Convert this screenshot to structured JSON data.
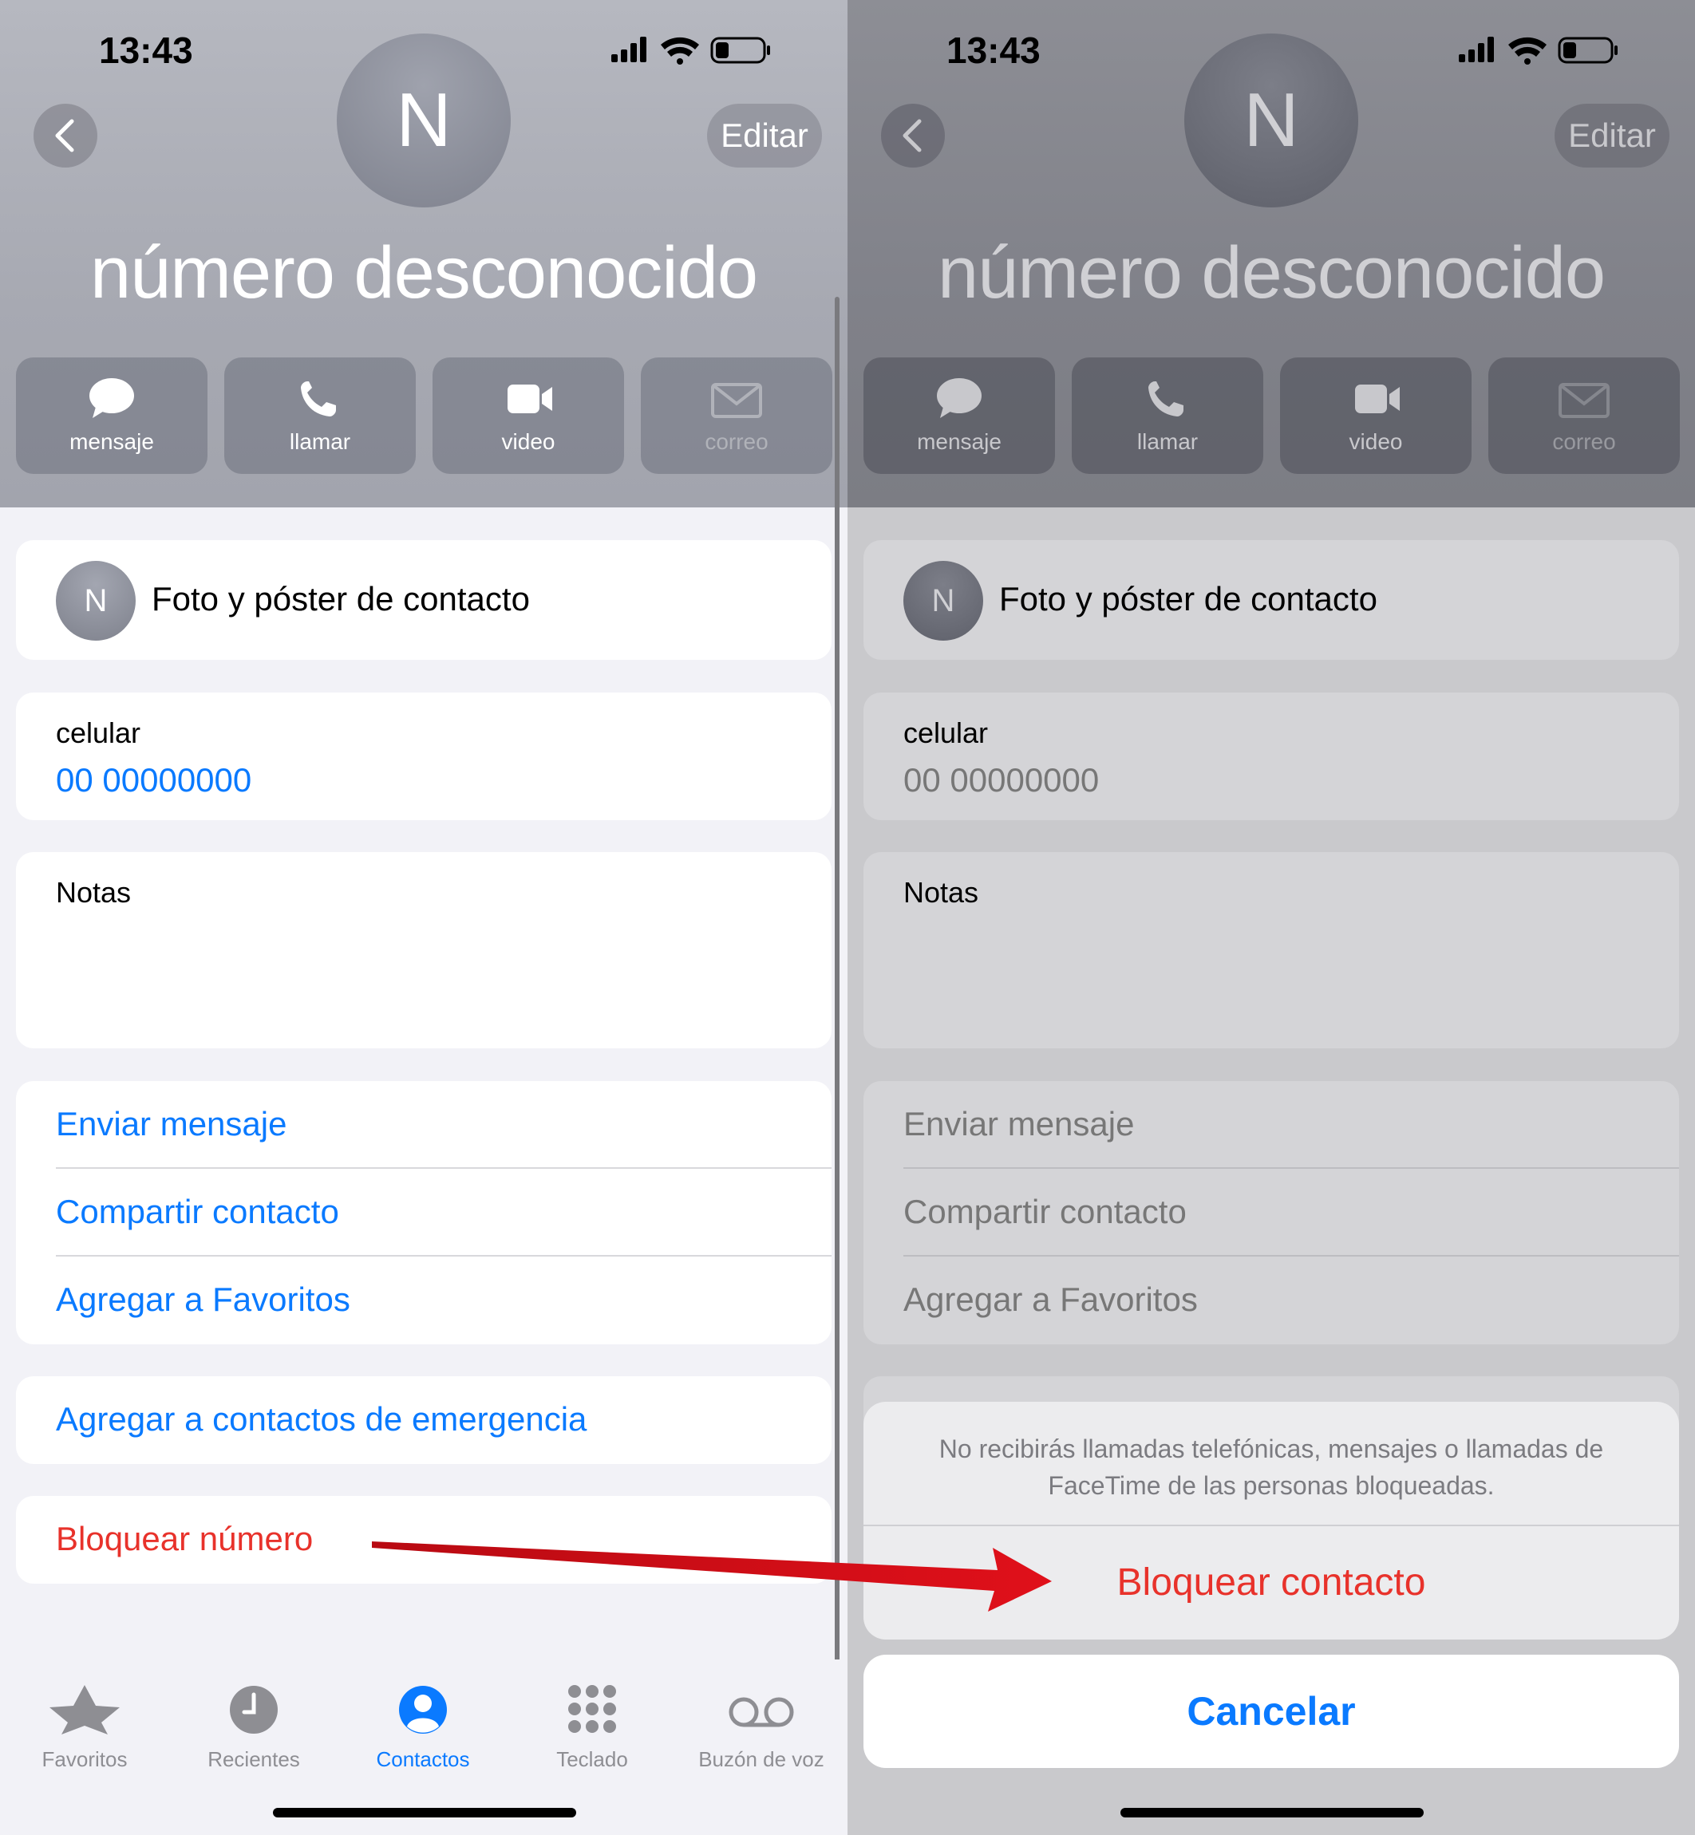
{
  "status": {
    "time": "13:43"
  },
  "header": {
    "edit_label": "Editar",
    "avatar_initial": "N",
    "contact_name": "número desconocido"
  },
  "actions": [
    {
      "label": "mensaje",
      "icon": "message-bubble-icon"
    },
    {
      "label": "llamar",
      "icon": "phone-icon"
    },
    {
      "label": "video",
      "icon": "video-camera-icon"
    },
    {
      "label": "correo",
      "icon": "envelope-icon"
    }
  ],
  "photo_row": {
    "initial": "N",
    "label": "Foto y póster de contacto"
  },
  "phone": {
    "label": "celular",
    "number": "00 00000000"
  },
  "notes": {
    "label": "Notas"
  },
  "links": {
    "send_message": "Enviar mensaje",
    "share_contact": "Compartir contacto",
    "add_favorites": "Agregar a Favoritos",
    "add_emergency": "Agregar a contactos de emergencia",
    "block_number": "Bloquear número"
  },
  "tabbar": [
    {
      "label": "Favoritos",
      "icon": "star-icon"
    },
    {
      "label": "Recientes",
      "icon": "clock-icon"
    },
    {
      "label": "Contactos",
      "icon": "person-circle-icon",
      "active": true
    },
    {
      "label": "Teclado",
      "icon": "keypad-icon"
    },
    {
      "label": "Buzón de voz",
      "icon": "voicemail-icon"
    }
  ],
  "sheet": {
    "message": "No recibirás llamadas telefónicas, mensajes o llamadas de FaceTime de las personas bloqueadas.",
    "block_contact": "Bloquear contacto",
    "cancel": "Cancelar"
  },
  "colors": {
    "link_blue": "#0a7aff",
    "danger_red": "#e8322b",
    "arrow_red": "#e0101a"
  }
}
